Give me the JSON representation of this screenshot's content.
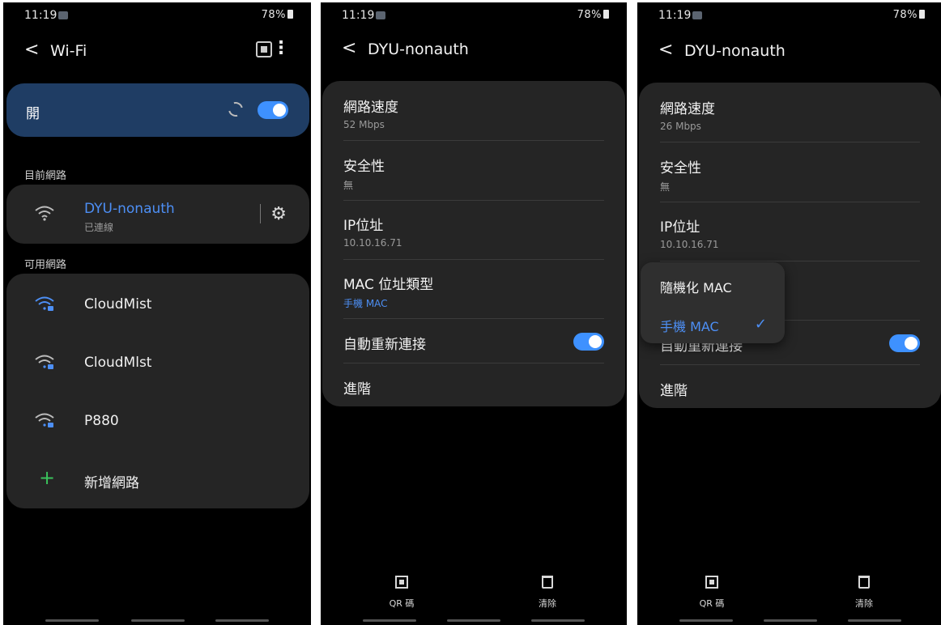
{
  "status_bar": {
    "time": "11:19",
    "icons": "⏰ ⚡ 📶 .ıl",
    "battery": "78%"
  },
  "panel1": {
    "title": "Wi-Fi",
    "switch_label": "開",
    "current_section": "目前網路",
    "current": {
      "name": "DYU-nonauth",
      "status": "已連線"
    },
    "available_section": "可用網路",
    "networks": [
      {
        "name": "CloudMist"
      },
      {
        "name": "CloudMlst"
      },
      {
        "name": "P880"
      }
    ],
    "add_network": "新增網路",
    "accent_color": "#3e91ff",
    "switch_bg": "#1f3d64"
  },
  "panel2": {
    "title": "DYU-nonauth",
    "rows": [
      {
        "title": "網路速度",
        "sub": "52 Mbps"
      },
      {
        "title": "安全性",
        "sub": "無"
      },
      {
        "title": "IP位址",
        "sub": "10.10.16.71"
      },
      {
        "title": "MAC 位址類型",
        "sub": "手機 MAC"
      }
    ],
    "auto_reconnect": "自動重新連接",
    "advanced": "進階",
    "qr_label": "QR 碼",
    "delete_label": "清除"
  },
  "panel3": {
    "title": "DYU-nonauth",
    "rows": [
      {
        "title": "網路速度",
        "sub": "26 Mbps"
      },
      {
        "title": "安全性",
        "sub": "無"
      },
      {
        "title": "IP位址",
        "sub": "10.10.16.71"
      }
    ],
    "auto_reconnect": "自動重新連接",
    "advanced": "進階",
    "popup": {
      "option1": "隨機化 MAC",
      "option2": "手機 MAC"
    },
    "qr_label": "QR 碼",
    "delete_label": "清除"
  }
}
